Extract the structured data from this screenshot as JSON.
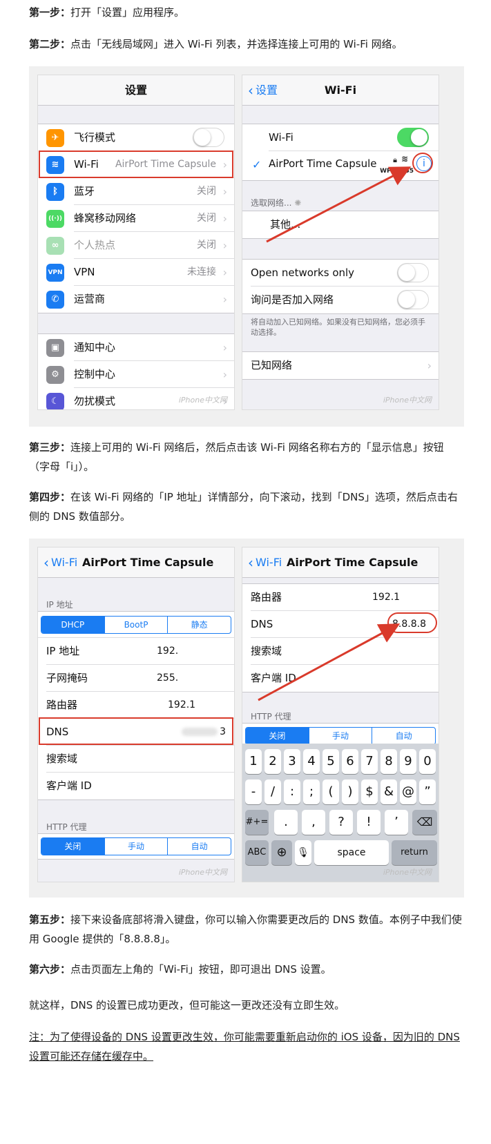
{
  "steps": {
    "s1_label": "第一步：",
    "s1_text": "打开「设置」应用程序。",
    "s2_label": "第二步：",
    "s2_text": "点击「无线局域网」进入 Wi-Fi 列表，并选择连接上可用的 Wi-Fi 网络。",
    "s3_label": "第三步：",
    "s3_text": "连接上可用的 Wi-Fi 网络后，然后点击该 Wi-Fi 网络名称右方的「显示信息」按钮（字母「i」）。",
    "s4_label": "第四步：",
    "s4_text": "在该 Wi-Fi 网络的「IP 地址」详情部分，向下滚动，找到「DNS」选项，然后点击右侧的 DNS 数值部分。",
    "s5_label": "第五步：",
    "s5_text": "接下来设备底部将滑入键盘，你可以输入你需要更改后的 DNS 数值。本例子中我们使用 Google 提供的「8.8.8.8」。",
    "s6_label": "第六步：",
    "s6_text": "点击页面左上角的「Wi-Fi」按钮，即可退出 DNS 设置。",
    "conclusion": "就这样，DNS 的设置已成功更改，但可能这一更改还没有立即生效。",
    "note": "注：为了使得设备的 DNS 设置更改生效，你可能需要重新启动你的 iOS 设备，因为旧的 DNS 设置可能还存储在缓存中。"
  },
  "watermark": "iPhone中文网",
  "settings_screen": {
    "title": "设置",
    "rows1": [
      {
        "label": "飞行模式",
        "icon": "airplane-icon",
        "color": "#ff9500",
        "glyph": "✈",
        "toggle": true
      },
      {
        "label": "Wi-Fi",
        "icon": "wifi-icon",
        "color": "#1a7cf2",
        "glyph": "≋",
        "value": "AirPort Time Capsule"
      },
      {
        "label": "蓝牙",
        "icon": "bluetooth-icon",
        "color": "#1a7cf2",
        "glyph": "ᛒ",
        "value": "关闭"
      },
      {
        "label": "蜂窝移动网络",
        "icon": "cellular-icon",
        "color": "#4cd964",
        "glyph": "((·))",
        "value": "关闭"
      },
      {
        "label": "个人热点",
        "icon": "hotspot-icon",
        "color": "#a8e0b4",
        "glyph": "∞",
        "value": "关闭",
        "dim": true
      },
      {
        "label": "VPN",
        "icon": "vpn-icon",
        "color": "#1a7cf2",
        "glyph": "VPN",
        "value": "未连接"
      },
      {
        "label": "运营商",
        "icon": "phone-icon",
        "color": "#1a7cf2",
        "glyph": "✆",
        "value": ""
      }
    ],
    "rows2": [
      {
        "label": "通知中心",
        "icon": "notification-icon",
        "color": "#8e8e93",
        "glyph": "▣"
      },
      {
        "label": "控制中心",
        "icon": "control-center-icon",
        "color": "#8e8e93",
        "glyph": "⚙"
      },
      {
        "label": "勿扰模式",
        "icon": "moon-icon",
        "color": "#5856d6",
        "glyph": "☾"
      }
    ]
  },
  "wifi_screen": {
    "back": "设置",
    "title": "Wi-Fi",
    "wifi_label": "Wi-Fi",
    "network": "AirPort Time Capsule",
    "security": "WPA2",
    "signal": "-55",
    "choose_header": "选取网络...",
    "other": "其他...",
    "open_only": "Open networks only",
    "ask_join": "询问是否加入网络",
    "ask_note": "将自动加入已知网络。如果没有已知网络，您必须手动选择。",
    "known": "已知网络"
  },
  "ip_screen": {
    "back": "Wi-Fi",
    "title": "AirPort Time Capsule",
    "ip_header": "IP 地址",
    "seg": [
      "DHCP",
      "BootP",
      "静态"
    ],
    "rows": [
      {
        "label": "IP 地址",
        "value": "192."
      },
      {
        "label": "子网掩码",
        "value": "255."
      },
      {
        "label": "路由器",
        "value": "192.1"
      },
      {
        "label": "DNS",
        "value": "3"
      },
      {
        "label": "搜索域",
        "value": ""
      },
      {
        "label": "客户端 ID",
        "value": ""
      }
    ],
    "http_header": "HTTP 代理",
    "http_seg": [
      "关闭",
      "手动",
      "自动"
    ]
  },
  "dns_screen": {
    "back": "Wi-Fi",
    "title": "AirPort Time Capsule",
    "rows": [
      {
        "label": "路由器",
        "value": "192.1"
      },
      {
        "label": "DNS",
        "value": "8.8.8.8"
      },
      {
        "label": "搜索域",
        "value": ""
      },
      {
        "label": "客户端 ID",
        "value": ""
      }
    ],
    "http_header": "HTTP 代理",
    "http_seg": [
      "关闭",
      "手动",
      "自动"
    ],
    "keyboard": {
      "row1": [
        "1",
        "2",
        "3",
        "4",
        "5",
        "6",
        "7",
        "8",
        "9",
        "0"
      ],
      "row2": [
        "-",
        "/",
        ":",
        ";",
        "(",
        ")",
        "$",
        "&",
        "@",
        "”"
      ],
      "row3": [
        ".",
        ",",
        "?",
        "!",
        "’"
      ],
      "sym": "#+=",
      "abc": "ABC",
      "space": "space",
      "ret": "return"
    }
  }
}
